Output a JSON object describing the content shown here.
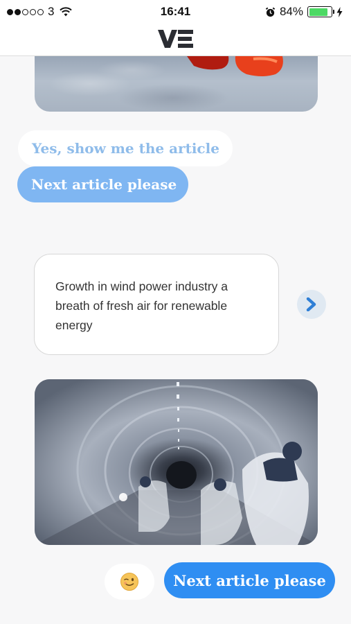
{
  "status_bar": {
    "carrier": "3",
    "time": "16:41",
    "battery": "84%",
    "battery_level": 0.84,
    "signal_bars_filled": 2,
    "signal_bars_total": 5
  },
  "header": {
    "logo_text": "VE"
  },
  "chat": {
    "reply_yes": "Yes, show me the article",
    "reply_next": "Next article please",
    "article_title": "Growth in wind power industry a breath of fresh air for renewable energy",
    "user_reply": "Next article please"
  },
  "colors": {
    "chip_light": "#7fb6f2",
    "chip_dark": "#2f8ef2",
    "chip_ghost_text": "#8fbcea",
    "arrow": "#2f7fd6",
    "battery_green": "#4cd964"
  },
  "icons": {
    "wifi": "wifi-icon",
    "alarm": "alarm-icon",
    "charging": "bolt-icon",
    "next": "chevron-right-icon",
    "emoji": "winking-face-icon"
  }
}
